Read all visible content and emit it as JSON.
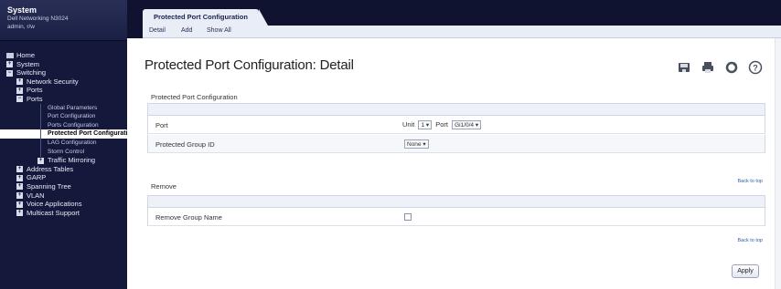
{
  "system": {
    "title": "System",
    "subtitle_line1": "Dell Networking N3024",
    "subtitle_line2": "admin, r/w"
  },
  "tree": [
    {
      "label": "Home",
      "icon": "page-icon"
    },
    {
      "label": "System",
      "icon": "plus-icon"
    },
    {
      "label": "Switching",
      "icon": "minus-icon"
    },
    {
      "label": "Network Security",
      "icon": "plus-icon"
    },
    {
      "label": "Ports",
      "icon": "plus-icon"
    },
    {
      "label": "Ports",
      "icon": "minus-icon"
    },
    {
      "label": "Global Parameters"
    },
    {
      "label": "Port Configuration"
    },
    {
      "label": "Ports Configuration"
    },
    {
      "label": "Protected Port Configuration"
    },
    {
      "label": "LAG Configuration"
    },
    {
      "label": "Storm Control"
    },
    {
      "label": "Traffic Mirroring",
      "icon": "plus-icon"
    },
    {
      "label": "Address Tables",
      "icon": "plus-icon"
    },
    {
      "label": "GARP",
      "icon": "plus-icon"
    },
    {
      "label": "Spanning Tree",
      "icon": "plus-icon"
    },
    {
      "label": "VLAN",
      "icon": "plus-icon"
    },
    {
      "label": "Voice Applications",
      "icon": "plus-icon"
    },
    {
      "label": "Multicast Support",
      "icon": "plus-icon"
    }
  ],
  "top_tab": "Protected Port Configuration",
  "sub_tabs": [
    "Detail",
    "Add",
    "Show All"
  ],
  "page_title": "Protected Port Configuration: Detail",
  "toolbar_icons": [
    "save-icon",
    "print-icon",
    "refresh-icon",
    "help-icon"
  ],
  "config_section": {
    "title": "Protected Port Configuration",
    "port_label": "Port",
    "unit_label": "Unit",
    "unit_value": "1",
    "port_word": "Port",
    "port_value": "Gi1/0/4",
    "group_label": "Protected Group ID",
    "group_value": "None"
  },
  "remove_section": {
    "title": "Remove",
    "row_label": "Remove Group Name"
  },
  "back_to_top": "Back to top",
  "apply_label": "Apply"
}
